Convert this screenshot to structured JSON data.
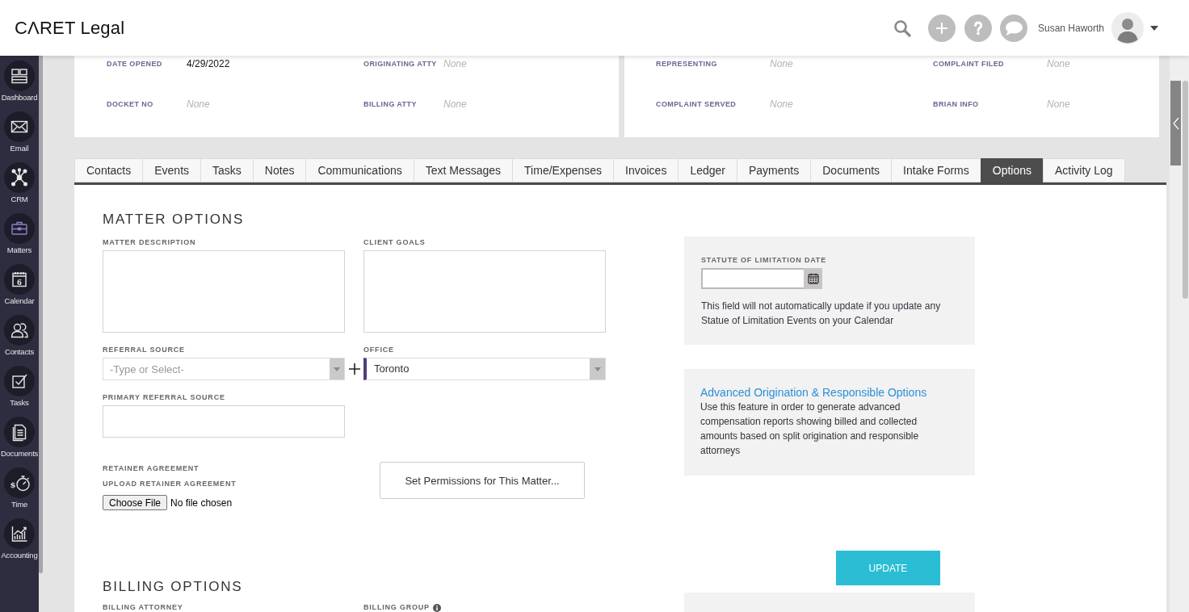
{
  "header": {
    "logo": "CΛRET Legal",
    "user_name": "Susan Haworth"
  },
  "sidebar": {
    "items": [
      {
        "label": "Dashboard",
        "selected": false
      },
      {
        "label": "Email",
        "selected": false
      },
      {
        "label": "CRM",
        "selected": false
      },
      {
        "label": "Matters",
        "selected": true
      },
      {
        "label": "Calendar",
        "selected": false,
        "icon_text": "6"
      },
      {
        "label": "Contacts",
        "selected": false
      },
      {
        "label": "Tasks",
        "selected": false
      },
      {
        "label": "Documents",
        "selected": false
      },
      {
        "label": "Time",
        "selected": false,
        "icon_text": "$"
      },
      {
        "label": "Accounting",
        "selected": false
      }
    ]
  },
  "matter_summary": {
    "cards": [
      {
        "fields": [
          {
            "label": "DATE OPENED",
            "value": "4/29/2022",
            "empty": false
          },
          {
            "label": "ORIGINATING ATTY",
            "value": "None",
            "empty": true
          },
          {
            "label": "DOCKET NO",
            "value": "None",
            "empty": true
          },
          {
            "label": "BILLING ATTY",
            "value": "None",
            "empty": true
          }
        ]
      },
      {
        "fields": [
          {
            "label": "REPRESENTING",
            "value": "None",
            "empty": true
          },
          {
            "label": "COMPLAINT FILED",
            "value": "None",
            "empty": true
          },
          {
            "label": "COMPLAINT SERVED",
            "value": "None",
            "empty": true
          },
          {
            "label": "BRIAN INFO",
            "value": "None",
            "empty": true
          }
        ]
      }
    ]
  },
  "tabs": [
    {
      "label": "Contacts",
      "selected": false
    },
    {
      "label": "Events",
      "selected": false
    },
    {
      "label": "Tasks",
      "selected": false
    },
    {
      "label": "Notes",
      "selected": false
    },
    {
      "label": "Communications",
      "selected": false
    },
    {
      "label": "Text Messages",
      "selected": false
    },
    {
      "label": "Time/Expenses",
      "selected": false
    },
    {
      "label": "Invoices",
      "selected": false
    },
    {
      "label": "Ledger",
      "selected": false
    },
    {
      "label": "Payments",
      "selected": false
    },
    {
      "label": "Documents",
      "selected": false
    },
    {
      "label": "Intake Forms",
      "selected": false
    },
    {
      "label": "Options",
      "selected": true
    },
    {
      "label": "Activity Log",
      "selected": false
    }
  ],
  "matter_options": {
    "title": "MATTER OPTIONS",
    "fields": [
      {
        "kind": "textarea",
        "label": "MATTER DESCRIPTION"
      },
      {
        "kind": "textarea",
        "label": "CLIENT GOALS"
      },
      {
        "kind": "combo",
        "label": "REFERRAL SOURCE",
        "placeholder": "-Type or Select-"
      },
      {
        "kind": "select",
        "label": "OFFICE",
        "value": "Toronto"
      },
      {
        "kind": "input",
        "label": "PRIMARY REFERRAL SOURCE"
      }
    ],
    "retainer": {
      "label": "RETAINER AGREEMENT",
      "upload_label": "UPLOAD RETAINER AGREEMENT",
      "file_button": "Choose File",
      "file_status": "No file chosen"
    },
    "permissions_button": "Set Permissions for This Matter..."
  },
  "side_panels": {
    "statute": {
      "label": "STATUTE OF LIMITATION DATE",
      "note": "This field will not automatically update if you update any Statue of Limitation Events on your Calendar"
    },
    "advanced": {
      "link": "Advanced Origination & Responsible Options",
      "description": "Use this feature in order to generate advanced compensation reports showing billed and collected amounts based on split origination and responsible attorneys"
    },
    "update_button": "UPDATE"
  },
  "billing_options": {
    "title": "BILLING OPTIONS",
    "fields": [
      {
        "label": "BILLING ATTORNEY",
        "info": false
      },
      {
        "label": "BILLING GROUP",
        "info": true
      }
    ]
  }
}
